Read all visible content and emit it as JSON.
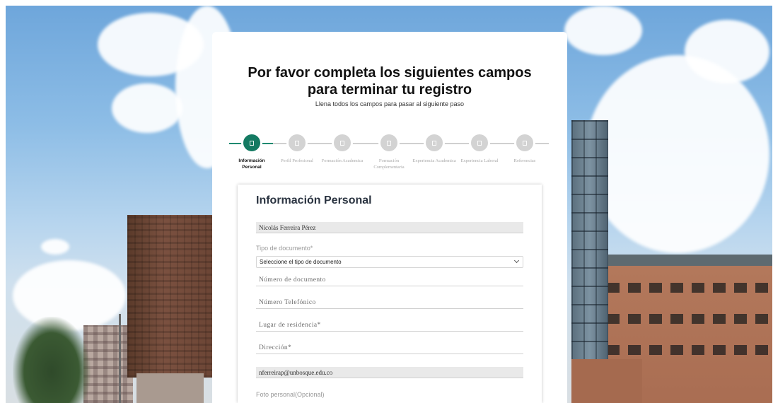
{
  "page": {
    "title": "Por favor completa los siguientes campos para terminar tu registro",
    "subtitle": "Llena todos los campos para pasar al siguiente paso"
  },
  "stepper": {
    "active_index": 0,
    "steps": [
      {
        "label": "Información Personal",
        "icon": "step-square-icon"
      },
      {
        "label": "Perfil Profesional",
        "icon": "step-square-icon"
      },
      {
        "label": "Formación Academica",
        "icon": "step-square-icon"
      },
      {
        "label": "Formación Complementaria",
        "icon": "step-square-icon"
      },
      {
        "label": "Experiencia Academica",
        "icon": "step-square-icon"
      },
      {
        "label": "Experiencia Laboral",
        "icon": "step-square-icon"
      },
      {
        "label": "Referencias",
        "icon": "step-square-icon"
      }
    ]
  },
  "form": {
    "title": "Información Personal",
    "full_name": "Nicolás Ferreira Pérez",
    "document_type_label": "Tipo de documento*",
    "document_type_selected": "Seleccione el tipo de documento",
    "document_number_placeholder": "Número de documento",
    "phone_placeholder": "Número Telefónico",
    "residence_placeholder": "Lugar de residencia*",
    "address_placeholder": "Dirección*",
    "email": "nferreirap@unbosque.edu.co",
    "photo_label": "Foto personal(Opcional)"
  },
  "colors": {
    "accent": "#147a62",
    "step_inactive": "#d3d3d3"
  }
}
